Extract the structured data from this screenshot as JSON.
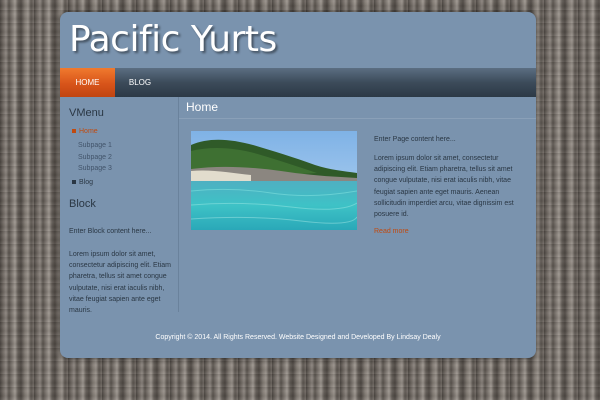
{
  "site": {
    "title": "Pacific Yurts"
  },
  "nav": {
    "items": [
      {
        "label": "HOME"
      },
      {
        "label": "BLOG"
      }
    ]
  },
  "vmenu": {
    "heading": "VMenu",
    "items": [
      {
        "label": "Home"
      },
      {
        "label": "Subpage 1"
      },
      {
        "label": "Subpage 2"
      },
      {
        "label": "Subpage 3"
      },
      {
        "label": "Blog"
      }
    ]
  },
  "block": {
    "heading": "Block",
    "intro": "Enter Block content here...",
    "text": "Lorem ipsum dolor sit amet, consectetur adipiscing elit. Etiam pharetra, tellus sit amet congue vulputate, nisi erat iaculis nibh, vitae feugiat sapien ante eget mauris."
  },
  "main": {
    "heading": "Home",
    "intro": "Enter Page content here...",
    "text": "Lorem ipsum dolor sit amet, consectetur adipiscing elit. Etiam pharetra, tellus sit amet congue vulputate, nisi erat iaculis nibh, vitae feugiat sapien ante eget mauris. Aenean sollicitudin imperdiet arcu, vitae dignissim est posuere id.",
    "read_more": "Read more"
  },
  "footer": {
    "text": "Copyright © 2014. All Rights Reserved. Website Designed and Developed By Lindsay Dealy"
  }
}
